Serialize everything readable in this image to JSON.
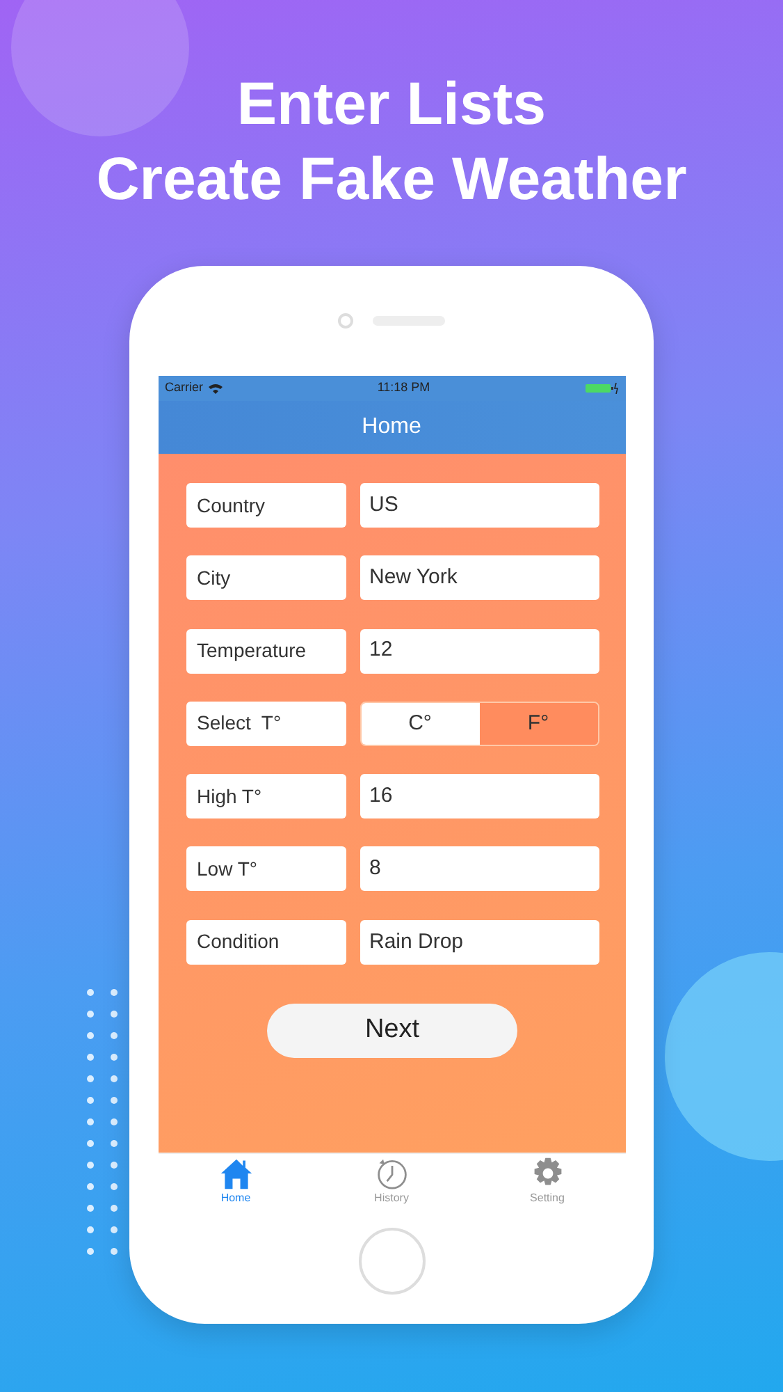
{
  "headline": [
    "Enter Lists",
    "Create Fake Weather"
  ],
  "status_bar": {
    "carrier": "Carrier",
    "time": "11:18 PM"
  },
  "nav_title": "Home",
  "fields": [
    {
      "kind": "input",
      "label": "Country",
      "value": "US"
    },
    {
      "kind": "input",
      "label": "City",
      "value": "New York"
    },
    {
      "kind": "input",
      "label": "Temperature",
      "value": "12"
    },
    {
      "kind": "segmented",
      "label": "Select  T°",
      "options": [
        {
          "label": "C°",
          "selected": false
        },
        {
          "label": "F°",
          "selected": true
        }
      ]
    },
    {
      "kind": "input",
      "label": "High T°",
      "value": "16"
    },
    {
      "kind": "input",
      "label": "Low T°",
      "value": "8"
    },
    {
      "kind": "input",
      "label": "Condition",
      "value": "Rain Drop"
    }
  ],
  "next_button": "Next",
  "tab_bar": [
    {
      "label": "Home",
      "selected": true
    },
    {
      "label": "History",
      "selected": false
    },
    {
      "label": "Setting",
      "selected": false
    }
  ]
}
